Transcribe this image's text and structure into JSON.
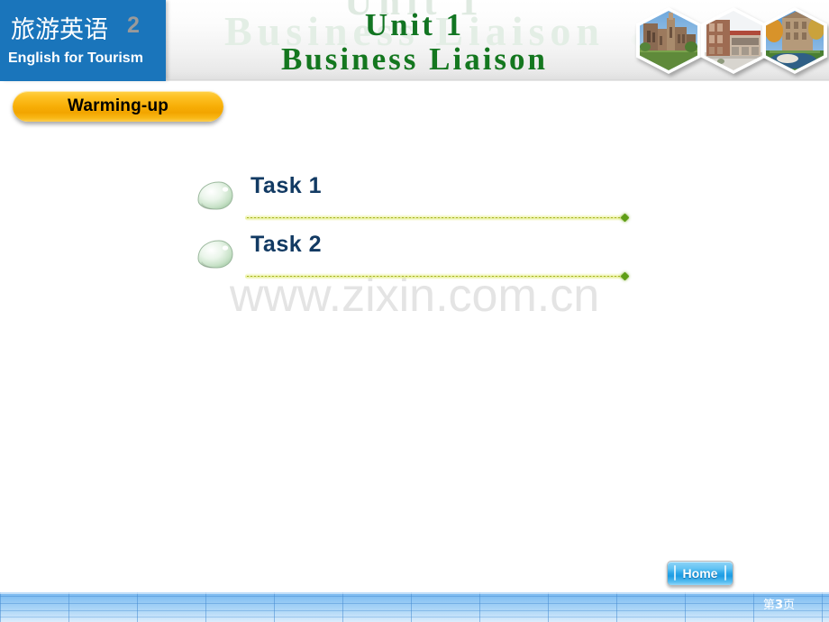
{
  "brand": {
    "title_cn": "旅游英语",
    "edition": "2",
    "subtitle_en": "English for Tourism"
  },
  "header": {
    "unit_label": "Unit 1",
    "main_title": "Business Liaison",
    "ghost_top": "Unit 1",
    "ghost_mid": "Business Liaison",
    "photos": [
      {
        "name": "hex-photo-campus-chapel",
        "alt": "campus chapel building"
      },
      {
        "name": "hex-photo-modern-building",
        "alt": "modern brick building"
      },
      {
        "name": "hex-photo-autumn-campus",
        "alt": "autumn campus scene"
      }
    ]
  },
  "section": {
    "button_label": "Warming-up"
  },
  "tasks": [
    {
      "label": "Task 1",
      "icon": "water-droplet-icon"
    },
    {
      "label": "Task 2",
      "icon": "water-droplet-icon"
    }
  ],
  "watermark": {
    "text": "www.zixin.com.cn"
  },
  "nav": {
    "home_label": "Home"
  },
  "footer": {
    "page_prefix": "第",
    "page_number": "3",
    "page_suffix": "页"
  },
  "colors": {
    "brand_blue": "#1a75bb",
    "title_green": "#14771f",
    "task_navy": "#123a63",
    "button_gold": "#f7ad05",
    "home_blue": "#2aa6e8",
    "rule_green": "#5f9e17",
    "footer_blue": "#79b8ef"
  }
}
